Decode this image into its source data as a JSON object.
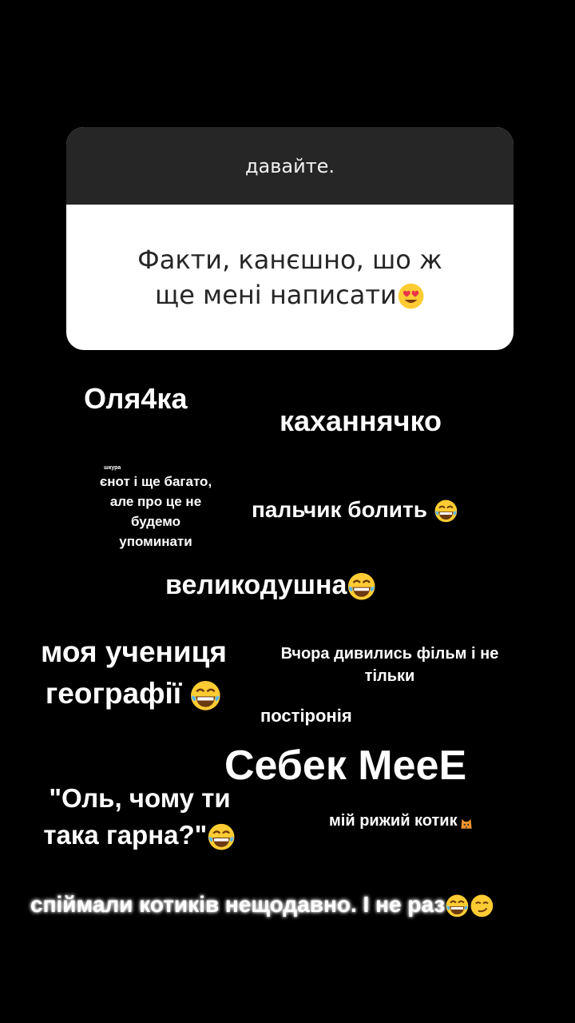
{
  "question_card": {
    "question": "давайте.",
    "answer_line1": "Факти, канєшно, шо ж",
    "answer_line2": "ще мені написати"
  },
  "stickers": {
    "olya": "Оля4ка",
    "kahannyachko": "каханнячко",
    "shkura": "шкура",
    "enot_line1": "єнот і ще багато,",
    "enot_line2": "але про це не",
    "enot_line3": "будемо",
    "enot_line4": "упоминати",
    "palchyk": "пальчик болить",
    "velykodushna": "великодушна",
    "uchenytsya_line1": "моя учениця",
    "uchenytsya_line2": "географії",
    "vchora_line1": "Вчора дивились фільм і не",
    "vchora_line2": "тільки",
    "postironiya": "постіронія",
    "sebek": "Себек МееЕ",
    "ol_line1": "\"Оль, чому ти",
    "ol_line2": "така гарна?\"",
    "kotyk": "мій рижий котик",
    "spiymaly": "спіймали котиків нещодавно. І не раз"
  },
  "colors": {
    "background": "#000000",
    "card_header": "#262626",
    "card_body": "#ffffff",
    "emoji_face": "#ffcc33"
  },
  "icons": [
    "heart-eyes-emoji-icon",
    "laughing-emoji-icon",
    "smirk-emoji-icon",
    "cat-emoji-icon"
  ]
}
